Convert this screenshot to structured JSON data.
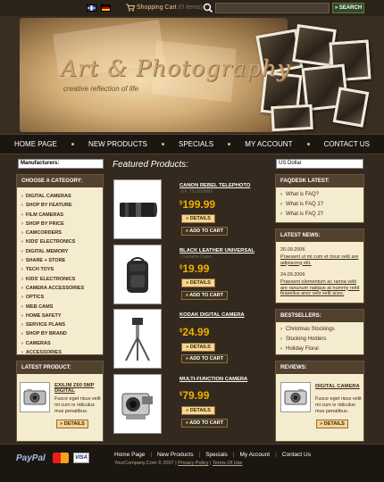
{
  "topbar": {
    "cart_label": "Shopping Cart",
    "cart_count": "(0 items)",
    "search_value": "",
    "search_button": "» SEARCH"
  },
  "header": {
    "logo_title": "Art & Photography",
    "logo_subtitle": "creative reflection of life"
  },
  "nav": {
    "items": [
      "HOME PAGE",
      "NEW PRODUCTS",
      "SPECIALS",
      "MY ACCOUNT",
      "CONTACT US"
    ]
  },
  "sidebar_left": {
    "manufacturers_select": "Manufacturers:",
    "category_heading": "CHOOSE A CATEGORY:",
    "categories": [
      "DIGITAL CAMERAS",
      "SHOP BY FEATURE",
      "FILM CAMERAS",
      "SHOP BY PRICE",
      "CAMCORDERS",
      "KIDS' ELECTRONICS",
      "DIGITAL MEMORY",
      "SHARE + STORE",
      "TECH TOYS",
      "KIDS' ELECTRONICS",
      "CAMERA ACCESSORIES",
      "OPTICS",
      "WEB CAMS",
      "HOME SAFETY",
      "SERVICE PLANS",
      "SHOP BY BRAND",
      "CAMERAS",
      "ACCESSORIES"
    ],
    "latest_heading": "LATEST PRODUCT:",
    "latest_title": "EXILIM Z60 5MP DIGITAL",
    "latest_desc": "Fusce eget risus velit mi cum is ridiculus mus penatibus.",
    "details_label": "» DETAILS"
  },
  "main": {
    "featured_title": "Featured Products:",
    "details_label": "» DETAILS",
    "add_to_cart_label": "» ADD TO CART",
    "products": [
      {
        "name": "CANON REBEL TELEPHOTO",
        "sub": "EF 75-300MM",
        "price": "199.99"
      },
      {
        "name": "BLACK LEATHER UNIVERSAL",
        "sub": "Camera Case",
        "price": "19.99"
      },
      {
        "name": "KODAK DIGITAL CAMERA",
        "sub": "",
        "price": "24.99"
      },
      {
        "name": "MULTI-FUNCTION CAMERA",
        "sub": "",
        "price": "79.99"
      }
    ],
    "currency_symbol": "$"
  },
  "sidebar_right": {
    "currency_select": "US Dollar",
    "faq_heading": "FAQDESK LATEST:",
    "faq_items": [
      "What is FAQ?",
      "What is FAQ 1?",
      "What is FAQ 2?"
    ],
    "news_heading": "LATEST NEWS:",
    "news": [
      {
        "date": "26.09.2006",
        "text": "Praesent ut mi cum et risus velit are adipiscing elit."
      },
      {
        "date": "24.09.2006",
        "text": "Praesent elementum ac ranna velit are ranunum natique at nummy reitit feaselius ares velit velit aces."
      }
    ],
    "best_heading": "BESTSELLERS:",
    "bestsellers": [
      "Christmas Stockings",
      "Stocking Holders",
      "Holiday Floral"
    ],
    "reviews_heading": "REVIEWS:",
    "review_title": "DIGITAL CAMERA",
    "review_desc": "Fusce eget risus velit mi cum is ridiculus mus penatibus.",
    "details_label": "» DETAILS"
  },
  "footer": {
    "paypal": "PayPal",
    "visa": "VISA",
    "links": [
      "Home Page",
      "New Products",
      "Specials",
      "My Account",
      "Contact Us"
    ],
    "copyright": "YourCompany.Com © 2007 |",
    "privacy": "Privacy Policy",
    "terms": "Terms Of Use"
  },
  "colors": {
    "background": "#33291f",
    "accent_price": "#f2b000",
    "box_fill": "#f5ebcf",
    "box_header": "#51412e"
  }
}
